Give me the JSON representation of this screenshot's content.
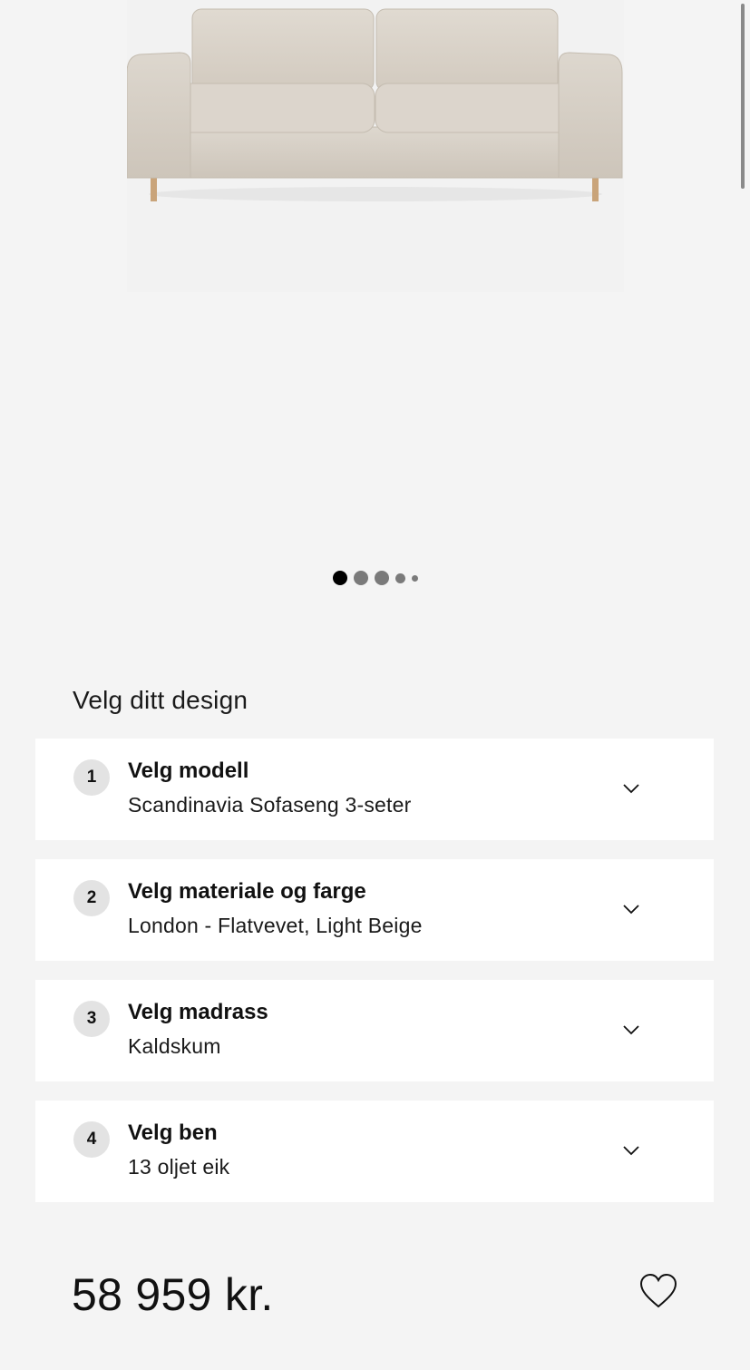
{
  "product": {
    "image_icon": "sofa-image"
  },
  "carousel": {
    "count": 5,
    "active_index": 0
  },
  "configurator": {
    "heading": "Velg ditt design",
    "steps": [
      {
        "number": "1",
        "title": "Velg modell",
        "value": "Scandinavia Sofaseng 3-seter"
      },
      {
        "number": "2",
        "title": "Velg materiale og farge",
        "value": "London - Flatvevet, Light Beige"
      },
      {
        "number": "3",
        "title": "Velg madrass",
        "value": "Kaldskum"
      },
      {
        "number": "4",
        "title": "Velg ben",
        "value": "13 oljet eik"
      }
    ],
    "chevron_icon": "chevron-down-icon"
  },
  "footer": {
    "price": "58 959 kr.",
    "favorite_icon": "heart-icon"
  },
  "colors": {
    "background": "#f4f4f4",
    "card": "#ffffff",
    "badge": "#e3e3e3",
    "active_dot": "#000000",
    "inactive_dot": "#7a7a7a",
    "sofa_fabric": "#d8d1c7",
    "sofa_legs": "#c9a47a"
  }
}
